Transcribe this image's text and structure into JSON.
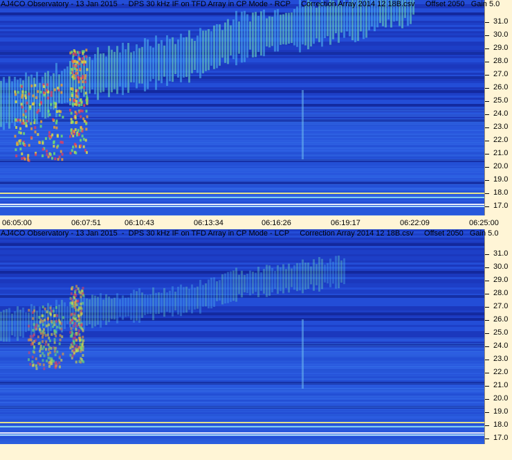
{
  "panels": [
    {
      "id": "rcp",
      "header": {
        "observatory": "AJ4CO Observatory",
        "date": "13 Jan 2015",
        "description": "DPS 30 kHz IF on TFD Array in CP Mode - RCP",
        "correction": "Correction Array 2014 12 18B.csv",
        "offset": "Offset 2050",
        "gain": "Gain 5.0"
      },
      "y_ticks": [
        "31.0",
        "30.0",
        "29.0",
        "28.0",
        "27.0",
        "26.0",
        "25.0",
        "24.0",
        "23.0",
        "22.0",
        "21.0",
        "20.0",
        "19.0",
        "18.0",
        "17.0"
      ],
      "x_ticks": [
        "06:05:00",
        "06:07:51",
        "06:10:43",
        "06:13:34",
        "06:16:26",
        "06:19:17",
        "06:22:09",
        "06:25:00"
      ]
    },
    {
      "id": "lcp",
      "header": {
        "observatory": "AJ4CO Observatory",
        "date": "13 Jan 2015",
        "description": "DPS 30 kHz IF on TFD Array in CP Mode - LCP",
        "correction": "Correction Array 2014 12 18B.csv",
        "offset": "Offset 2050",
        "gain": "Gain 5.0"
      },
      "y_ticks": [
        "31.0",
        "30.0",
        "29.0",
        "28.0",
        "27.0",
        "26.0",
        "25.0",
        "24.0",
        "23.0",
        "22.0",
        "21.0",
        "20.0",
        "19.0",
        "18.0",
        "17.0"
      ]
    }
  ],
  "colors": {
    "background": "#fff5d6",
    "spectrogram_base": "#1a3cc8"
  }
}
